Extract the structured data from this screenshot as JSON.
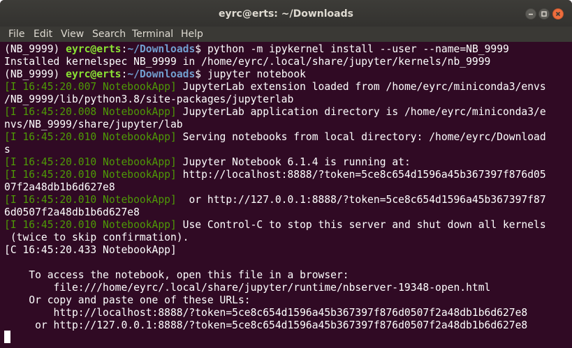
{
  "window": {
    "title": "eyrc@erts: ~/Downloads"
  },
  "menu": {
    "items": [
      "File",
      "Edit",
      "View",
      "Search",
      "Terminal",
      "Help"
    ]
  },
  "prompt": {
    "env": "(NB_9999) ",
    "user_host": "eyrc@erts",
    "colon": ":",
    "path": "~/Downloads",
    "symbol": "$ "
  },
  "terminal": {
    "cmd1": "python -m ipykernel install --user --name=NB_9999",
    "out1": "Installed kernelspec NB_9999 in /home/eyrc/.local/share/jupyter/kernels/nb_9999",
    "cmd2": "jupyter notebook",
    "log": [
      {
        "prefix": "[I 16:45:20.007 NotebookApp]",
        "text": " JupyterLab extension loaded from /home/eyrc/miniconda3/envs",
        "cont": "/NB_9999/lib/python3.8/site-packages/jupyterlab"
      },
      {
        "prefix": "[I 16:45:20.008 NotebookApp]",
        "text": " JupyterLab application directory is /home/eyrc/miniconda3/e",
        "cont": "nvs/NB_9999/share/jupyter/lab"
      },
      {
        "prefix": "[I 16:45:20.010 NotebookApp]",
        "text": " Serving notebooks from local directory: /home/eyrc/Download",
        "cont": "s"
      },
      {
        "prefix": "[I 16:45:20.010 NotebookApp]",
        "text": " Jupyter Notebook 6.1.4 is running at:",
        "cont": null
      },
      {
        "prefix": "[I 16:45:20.010 NotebookApp]",
        "text": " http://localhost:8888/?token=5ce8c654d1596a45b367397f876d05",
        "cont": "07f2a48db1b6d627e8"
      },
      {
        "prefix": "[I 16:45:20.010 NotebookApp]",
        "text": "  or http://127.0.0.1:8888/?token=5ce8c654d1596a45b367397f87",
        "cont": "6d0507f2a48db1b6d627e8"
      },
      {
        "prefix": "[I 16:45:20.010 NotebookApp]",
        "text": " Use Control-C to stop this server and shut down all kernels",
        "cont": " (twice to skip confirmation)."
      }
    ],
    "critical": "[C 16:45:20.433 NotebookApp]",
    "access_lines": [
      "    To access the notebook, open this file in a browser:",
      "        file:///home/eyrc/.local/share/jupyter/runtime/nbserver-19348-open.html",
      "    Or copy and paste one of these URLs:",
      "        http://localhost:8888/?token=5ce8c654d1596a45b367397f876d0507f2a48db1b6d627e8",
      "     or http://127.0.0.1:8888/?token=5ce8c654d1596a45b367397f876d0507f2a48db1b6d627e8"
    ]
  },
  "colors": {
    "background": "#300a24",
    "user": "#8ae234",
    "path": "#729fcf",
    "log_prefix": "#4e9a06",
    "text": "#ffffff"
  },
  "icons": {
    "minimize": "minimize-icon",
    "maximize": "maximize-icon",
    "close": "close-icon"
  }
}
